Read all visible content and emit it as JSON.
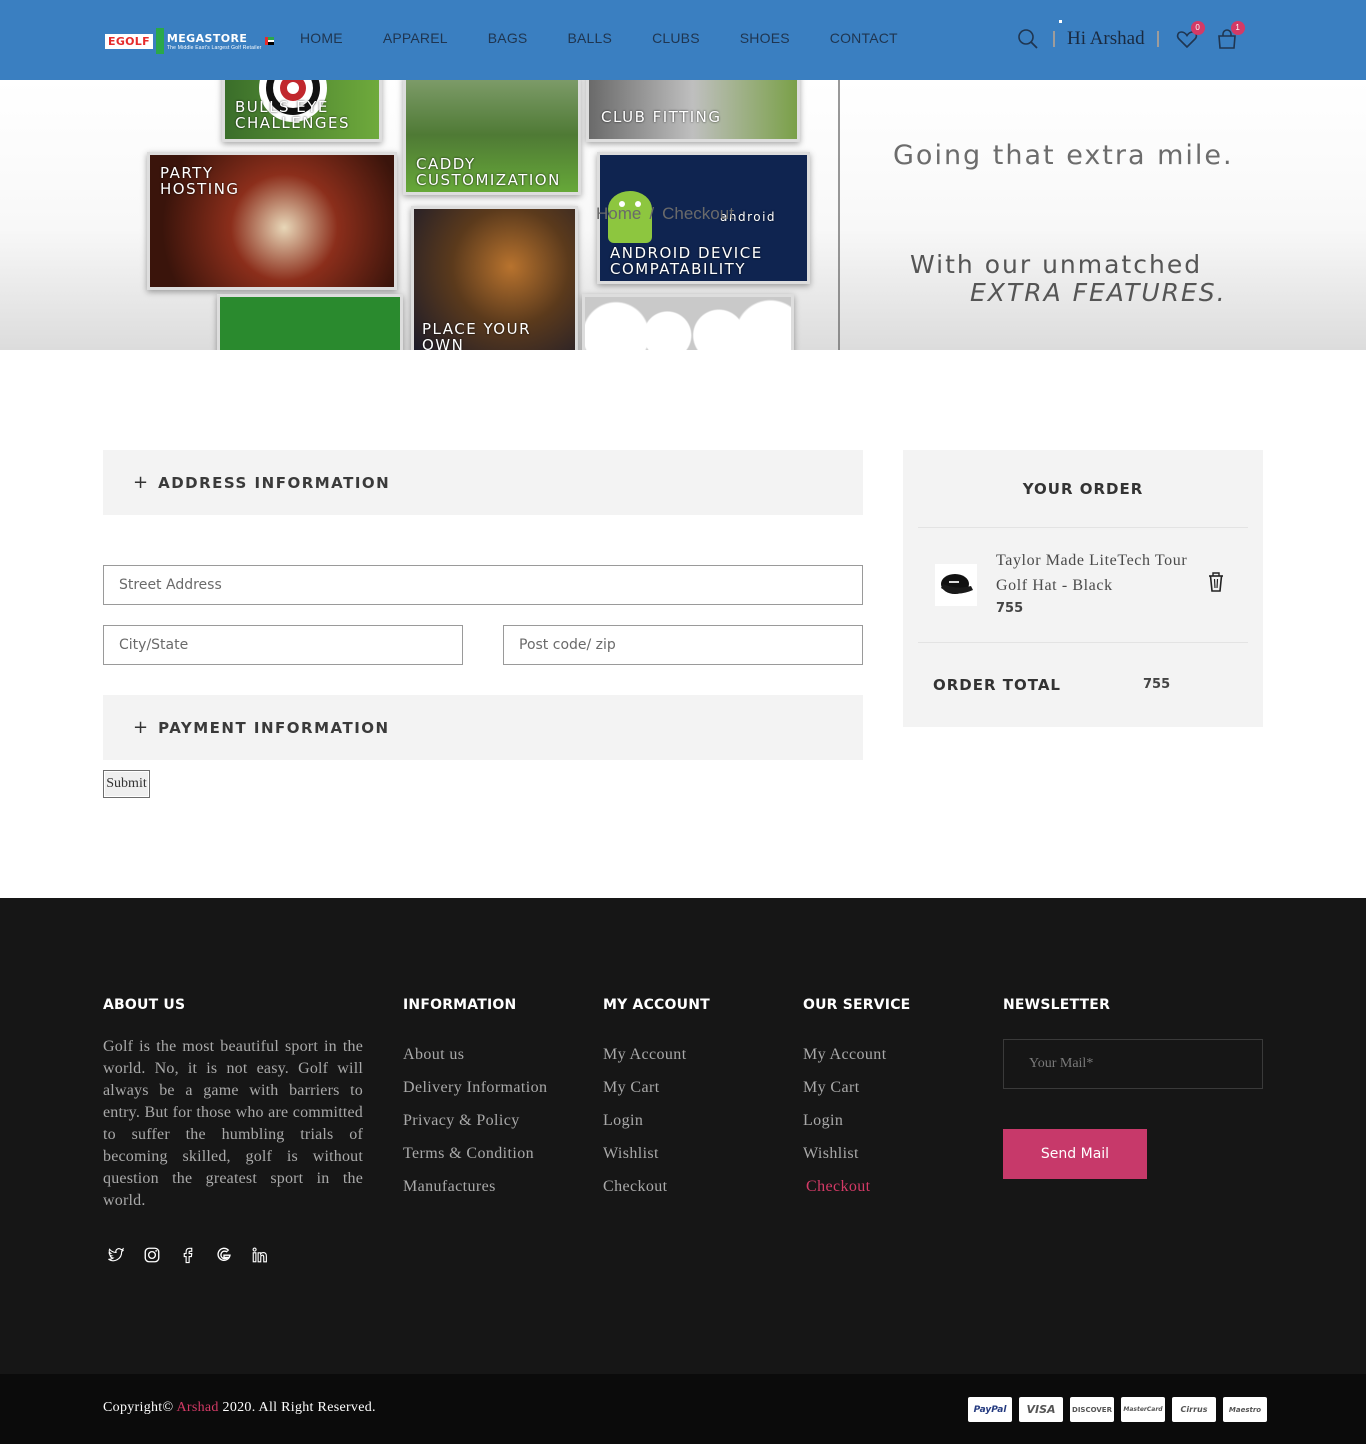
{
  "header": {
    "logo": {
      "brand_left": "EGOLF",
      "brand_right": "MEGASTORE",
      "tagline": "The Middle East's Largest Golf Retailer"
    },
    "nav": [
      "HOME",
      "APPAREL",
      "BAGS",
      "BALLS",
      "CLUBS",
      "SHOES",
      "CONTACT"
    ],
    "greeting": "Hi Arshad",
    "wishlist_count": "0",
    "cart_count": "1"
  },
  "banner": {
    "tiles": [
      "BULLS EYE CHALLENGES",
      "PARTY HOSTING",
      "CADDY CUSTOMIZATION",
      "CLUB FITTING",
      "ANDROID DEVICE COMPATABILITY",
      "PLACE YOUR OWN"
    ],
    "android_word": "android",
    "slogan_line1": "Going that extra mile.",
    "slogan_line2": "With our unmatched",
    "slogan_line3": "EXTRA FEATURES.",
    "breadcrumb": {
      "home": "Home",
      "separator": "/",
      "current": "Checkout"
    }
  },
  "checkout": {
    "address_heading": "ADDRESS INFORMATION",
    "street_placeholder": "Street Address",
    "city_placeholder": "City/State",
    "post_placeholder": "Post code/ zip",
    "payment_heading": "PAYMENT INFORMATION",
    "submit_label": "Submit"
  },
  "order": {
    "title": "YOUR ORDER",
    "item_name": "Taylor Made LiteTech Tour Golf Hat - Black",
    "item_price": "755",
    "total_label": "ORDER TOTAL",
    "total_value": "755"
  },
  "footer": {
    "about_heading": "ABOUT US",
    "about_text": "Golf is the most beautiful sport in the world. No, it is not easy. Golf will always be a game with barriers to entry. But for those who are committed to suffer the humbling trials of becoming skilled, golf is without question the greatest sport in the world.",
    "information_heading": "INFORMATION",
    "information_links": [
      "About us",
      "Delivery Information",
      "Privacy & Policy",
      "Terms & Condition",
      "Manufactures"
    ],
    "account_heading": "MY ACCOUNT",
    "account_links": [
      "My Account",
      "My Cart",
      "Login",
      "Wishlist",
      "Checkout"
    ],
    "service_heading": "OUR SERVICE",
    "service_links": [
      "My Account",
      "My Cart",
      "Login",
      "Wishlist",
      "Checkout"
    ],
    "newsletter_heading": "NEWSLETTER",
    "newsletter_placeholder": "Your Mail*",
    "send_label": "Send Mail",
    "social_icons": [
      "twitter-icon",
      "instagram-icon",
      "facebook-icon",
      "google-icon",
      "linkedin-icon"
    ]
  },
  "bottom": {
    "copyright_prefix": "Copyright©",
    "copyright_name": "Arshad",
    "copyright_suffix": "2020. All Right Reserved.",
    "payment_methods": [
      "PayPal",
      "VISA",
      "DISCOVER",
      "MasterCard",
      "Cirrus",
      "Maestro"
    ]
  },
  "colors": {
    "header_bg": "#3a7fc1",
    "accent": "#d33a66",
    "footer_bg": "#161616"
  }
}
